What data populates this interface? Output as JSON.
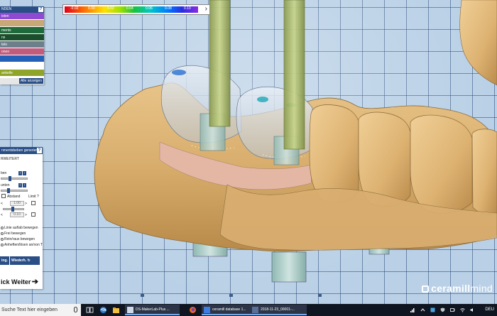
{
  "color_scale": {
    "ticks": [
      "-0.02",
      "0.00",
      "0.02",
      "0.04",
      "0.06",
      "0.08",
      "0.10"
    ],
    "arrow": "›",
    "gradient_colors": [
      "#e0001c",
      "#ff6a00",
      "#ffe100",
      "#9be000",
      "#19c23b",
      "#00c8c8",
      "#0077ff",
      "#2a2ee0",
      "#8a2be2"
    ]
  },
  "layers": {
    "header": "NDEN",
    "help": "?",
    "rows": [
      {
        "label": "isten",
        "color": "#8e4bd1"
      },
      {
        "label": "",
        "color": "#c9a877"
      },
      {
        "label": "ments",
        "color": "#1f6a3a"
      },
      {
        "label": "ns",
        "color": "#1b4e2c"
      },
      {
        "label": "tele",
        "color": "#6e7f8c"
      },
      {
        "label": "onen",
        "color": "#c25c7c"
      },
      {
        "label": "",
        "color": "#2460b8"
      },
      {
        "label": "",
        "color": "#ffffff"
      },
      {
        "label": "ankelle",
        "color": "#8fa52a"
      },
      {
        "label": "",
        "color": "#ffffff"
      }
    ],
    "show_all": "Alle anzeigen"
  },
  "tool_panel": {
    "title": "nmentsbeben generieren",
    "help": "?",
    "section": "RWEITERT",
    "labels": {
      "oben": "ben",
      "unten": "unten",
      "abstand": "Abstand",
      "limit": "Limit ?",
      "val1": "1.00",
      "val2": "0.10"
    },
    "options": [
      "Linie auf/ab bewegen",
      "Frei bewegen",
      "Rein/raus bewegen",
      "Anheften/lösen an/von T"
    ],
    "buttons": {
      "apply": "ing.",
      "restore": "Wiederh."
    },
    "next": "ick  Weiter",
    "next_arrow": "➔"
  },
  "brand": {
    "bold": "ceramill",
    "light": "mind"
  },
  "taskbar": {
    "search_placeholder": "Suche Text hier eingeben",
    "apps": [
      {
        "label": "DS-MakerLab-Plus ...",
        "color": "#cfd8e6"
      },
      {
        "label": "ceramill database 1...",
        "color": "#3e7ce0"
      },
      {
        "label": "2018-11-23_00001-...",
        "color": "#5a6e9a"
      }
    ],
    "lang": "DEU"
  }
}
